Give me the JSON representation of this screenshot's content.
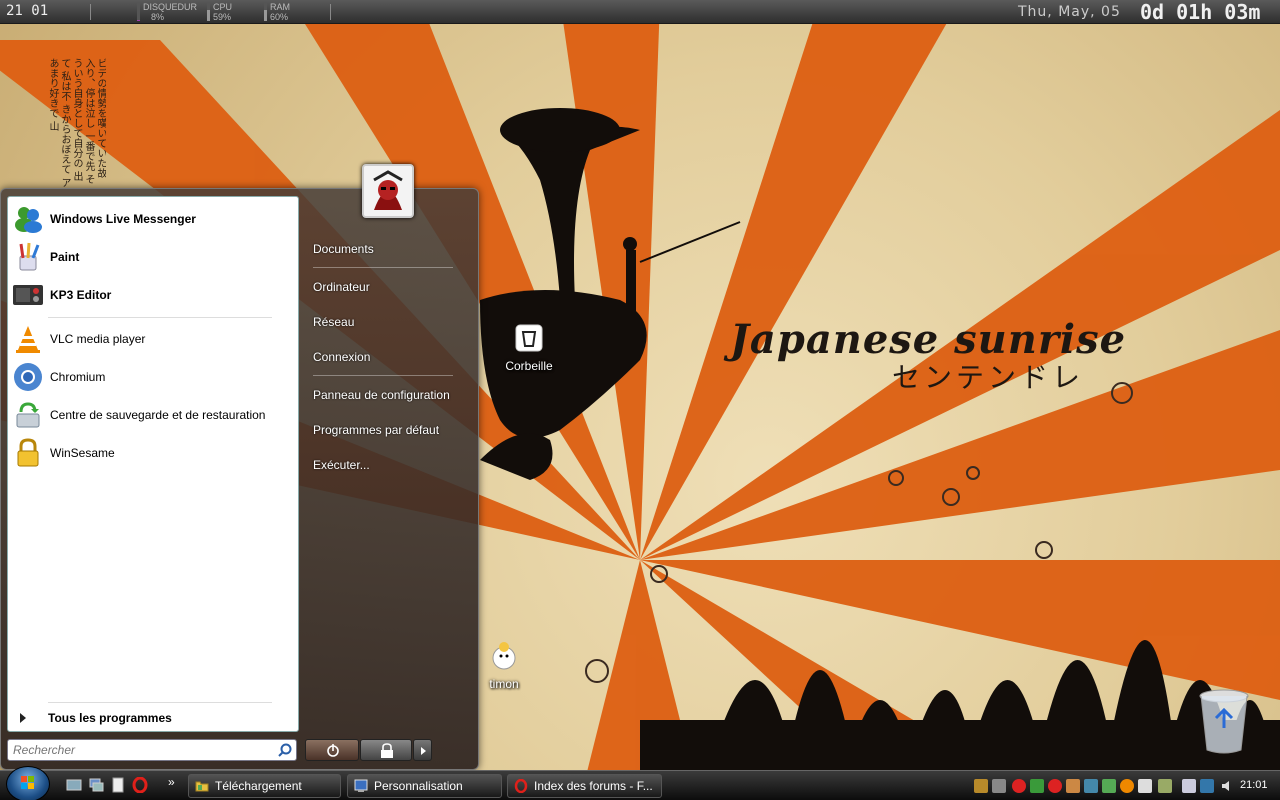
{
  "topbar": {
    "time": "21 01",
    "meters": [
      {
        "label": "DISQUEDUR",
        "value": "8%",
        "level": 0.08
      },
      {
        "label": "CPU",
        "value": "59%",
        "level": 0.59
      },
      {
        "label": "RAM",
        "value": "60%",
        "level": 0.6
      }
    ],
    "date": "Thu, May, 05",
    "uptime": "0d 01h 03m"
  },
  "wallpaper": {
    "title": "Japanese sunrise",
    "kana": "センテンドレ",
    "vertical_text": "ビデの情勢を嘆いていた故 入り、停は泣し 一番で先 そういう自身として自分の 出て 私は不 きからおぼえて アあまり好きで 山"
  },
  "desktop": {
    "icons": [
      {
        "label": "Corbeille",
        "icon": "trash-icon"
      },
      {
        "label": "timon",
        "icon": "user-folder-icon"
      }
    ]
  },
  "start_menu": {
    "pinned": [
      {
        "label": "Windows Live Messenger",
        "icon": "messenger-icon"
      },
      {
        "label": "Paint",
        "icon": "paint-icon"
      },
      {
        "label": "KP3 Editor",
        "icon": "kp3-editor-icon"
      }
    ],
    "recent": [
      {
        "label": "VLC media player",
        "icon": "vlc-icon"
      },
      {
        "label": "Chromium",
        "icon": "chromium-icon"
      },
      {
        "label": "Centre de sauvegarde et de restauration",
        "icon": "backup-icon"
      },
      {
        "label": "WinSesame",
        "icon": "lock-icon"
      }
    ],
    "all_programs": "Tous les programmes",
    "search_placeholder": "Rechercher",
    "right": [
      {
        "label": "Documents"
      },
      {
        "label": "Ordinateur"
      },
      {
        "label": "Réseau"
      },
      {
        "label": "Connexion"
      },
      {
        "label": "Panneau de configuration"
      },
      {
        "label": "Programmes par défaut"
      },
      {
        "label": "Exécuter..."
      }
    ]
  },
  "taskbar": {
    "buttons": [
      {
        "label": "Téléchargement",
        "icon": "folder-icon"
      },
      {
        "label": "Personnalisation",
        "icon": "personalization-icon"
      },
      {
        "label": "Index des forums - F...",
        "icon": "opera-icon"
      }
    ],
    "clock": "21:01",
    "quicklaunch_more": "»"
  },
  "colors": {
    "accent": "#e0661a",
    "meter_fill": "#a040b0"
  }
}
